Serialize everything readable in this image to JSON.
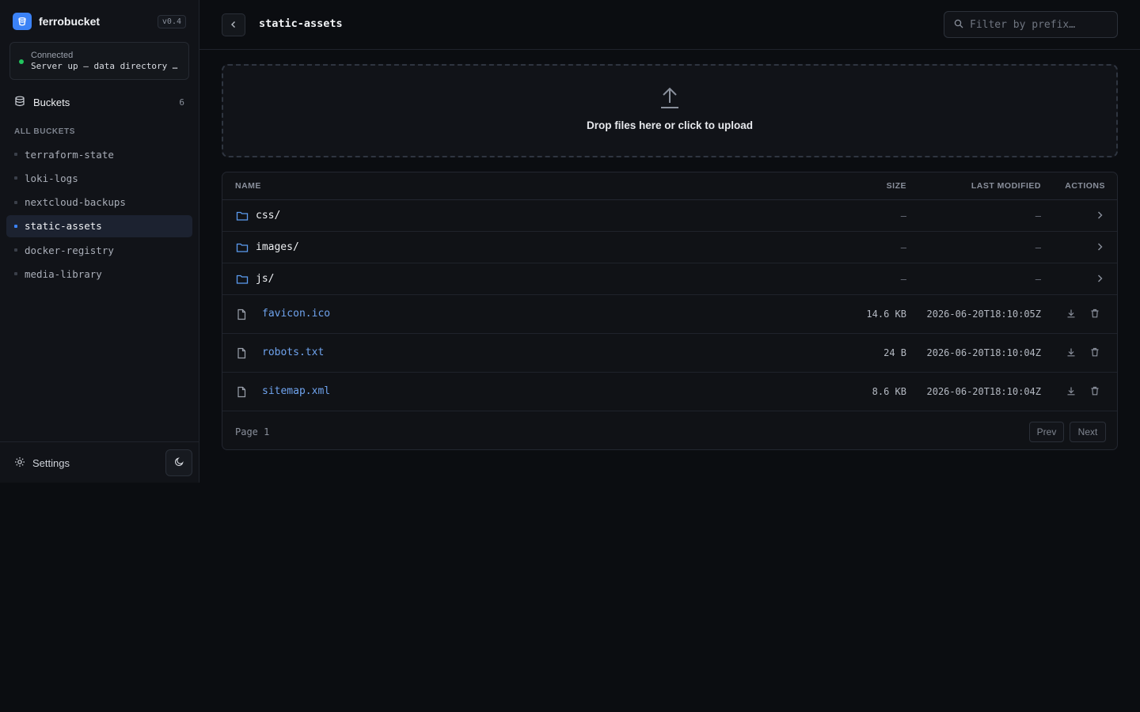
{
  "brand": {
    "name": "ferrobucket",
    "version": "v0.4",
    "accent": "#3b82f6"
  },
  "connection": {
    "title": "Connected",
    "detail": "Server up — data directory …",
    "status_color": "#22c55e"
  },
  "nav": {
    "buckets_label": "Buckets",
    "buckets_count": "6",
    "icon": "database-icon"
  },
  "sidebar": {
    "section_label": "ALL BUCKETS",
    "buckets": [
      {
        "name": "terraform-state",
        "active": false
      },
      {
        "name": "loki-logs",
        "active": false
      },
      {
        "name": "nextcloud-backups",
        "active": false
      },
      {
        "name": "static-assets",
        "active": true
      },
      {
        "name": "docker-registry",
        "active": false
      },
      {
        "name": "media-library",
        "active": false
      }
    ],
    "settings_label": "Settings",
    "theme_icon": "moon-icon"
  },
  "header": {
    "title": "static-assets",
    "search_placeholder": "Filter by prefix…"
  },
  "upload": {
    "text": "Drop files here or click to upload"
  },
  "table": {
    "columns": {
      "name": "NAME",
      "size": "SIZE",
      "modified": "LAST MODIFIED",
      "actions": "ACTIONS"
    },
    "folders": [
      {
        "name": "css/",
        "size": "–",
        "modified": "–"
      },
      {
        "name": "images/",
        "size": "–",
        "modified": "–"
      },
      {
        "name": "js/",
        "size": "–",
        "modified": "–"
      }
    ],
    "files": [
      {
        "name": "favicon.ico",
        "size": "14.6 KB",
        "modified": "2026-06-20T18:10:05Z"
      },
      {
        "name": "robots.txt",
        "size": "24 B",
        "modified": "2026-06-20T18:10:04Z"
      },
      {
        "name": "sitemap.xml",
        "size": "8.6 KB",
        "modified": "2026-06-20T18:10:04Z"
      }
    ],
    "page_label": "Page 1",
    "prev_label": "Prev",
    "next_label": "Next"
  }
}
